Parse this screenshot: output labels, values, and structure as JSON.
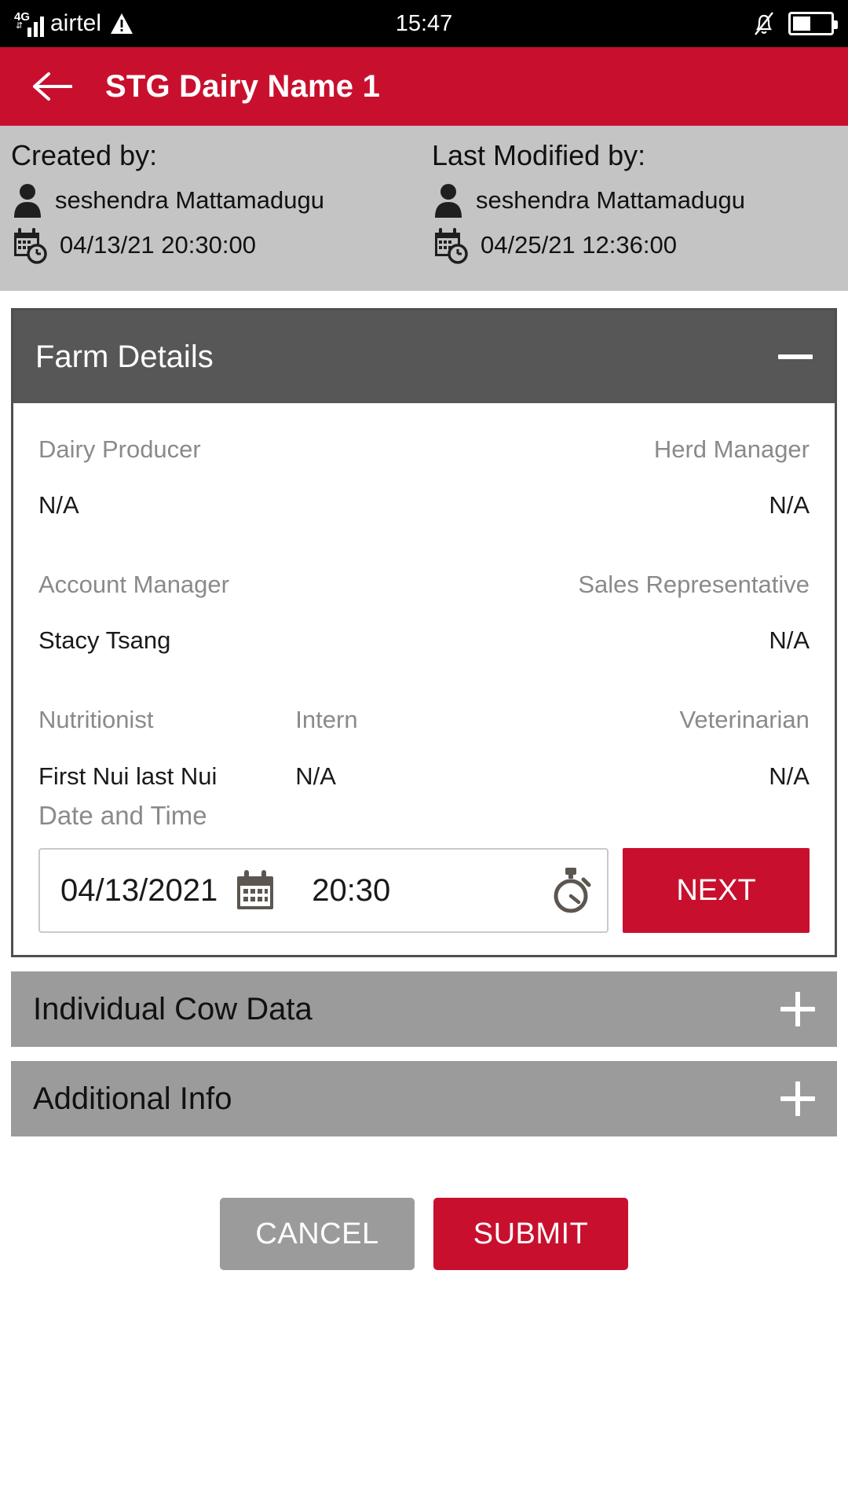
{
  "status_bar": {
    "network_type": "4G",
    "carrier": "airtel",
    "warning_icon": "warning-triangle-icon",
    "time": "15:47",
    "bell_icon": "bell-off-icon",
    "battery_icon": "battery-half-icon"
  },
  "app_bar": {
    "back_icon": "back-arrow-icon",
    "title": "STG Dairy Name 1",
    "background": "#c8102e"
  },
  "meta": {
    "created": {
      "heading": "Created by:",
      "user_icon": "person-icon",
      "user": "seshendra Mattamadugu",
      "date_icon": "calendar-clock-icon",
      "timestamp": "04/13/21 20:30:00"
    },
    "modified": {
      "heading": "Last Modified by:",
      "user_icon": "person-icon",
      "user": "seshendra Mattamadugu",
      "date_icon": "calendar-clock-icon",
      "timestamp": "04/25/21 12:36:00"
    }
  },
  "farm_details": {
    "title": "Farm Details",
    "toggle_icon": "minus-icon",
    "expanded": true,
    "fields": [
      {
        "label": "Dairy Producer",
        "value": "N/A"
      },
      {
        "label": "Herd Manager",
        "value": "N/A"
      },
      {
        "label": "Account Manager",
        "value": "Stacy Tsang"
      },
      {
        "label": "Sales Representative",
        "value": "N/A"
      },
      {
        "label": "Nutritionist",
        "value": "First Nui last Nui"
      },
      {
        "label": "Intern",
        "value": "N/A"
      },
      {
        "label": "Veterinarian",
        "value": "N/A"
      }
    ],
    "date_time": {
      "label": "Date and Time",
      "date_value": "04/13/2021",
      "date_icon": "calendar-icon",
      "time_value": "20:30",
      "time_icon": "stopwatch-icon",
      "next_label": "NEXT"
    }
  },
  "sections": [
    {
      "title": "Individual Cow Data",
      "toggle_icon": "plus-icon"
    },
    {
      "title": "Additional Info",
      "toggle_icon": "plus-icon"
    }
  ],
  "footer": {
    "cancel_label": "CANCEL",
    "submit_label": "SUBMIT"
  },
  "colors": {
    "brand_red": "#c8102e",
    "header_dark": "#575757",
    "meta_gray": "#c4c4c4",
    "section_gray": "#9b9b9b",
    "label_gray": "#8a8a8a"
  }
}
